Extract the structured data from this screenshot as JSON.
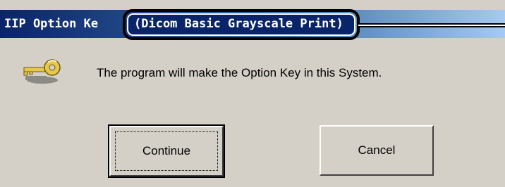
{
  "window": {
    "title_prefix": "IIP Option Ke",
    "title_highlight": "(Dicom Basic Grayscale Print)"
  },
  "body": {
    "icon": "key-icon",
    "message": "The program will make the Option Key in this System."
  },
  "buttons": {
    "continue_label": "Continue",
    "cancel_label": "Cancel"
  },
  "colors": {
    "dialog_bg": "#d4d0c8",
    "titlebar_start": "#0a246a",
    "titlebar_end": "#a6caf0",
    "key_gold": "#e8c84a"
  }
}
